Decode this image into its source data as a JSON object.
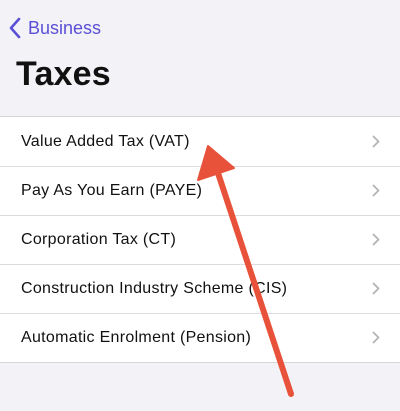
{
  "nav": {
    "back_label": "Business",
    "title": "Taxes"
  },
  "list": {
    "items": [
      {
        "label": "Value Added Tax (VAT)"
      },
      {
        "label": "Pay As You Earn (PAYE)"
      },
      {
        "label": "Corporation Tax (CT)"
      },
      {
        "label": "Construction Industry Scheme (CIS)"
      },
      {
        "label": "Automatic Enrolment (Pension)"
      }
    ]
  },
  "colors": {
    "accent": "#5b4fd6",
    "annotation_arrow": "#e8523a",
    "background": "#f2f2f7"
  },
  "icons": {
    "back": "chevron-left-icon",
    "row": "chevron-right-icon",
    "annotation": "arrow-annotation-icon"
  }
}
